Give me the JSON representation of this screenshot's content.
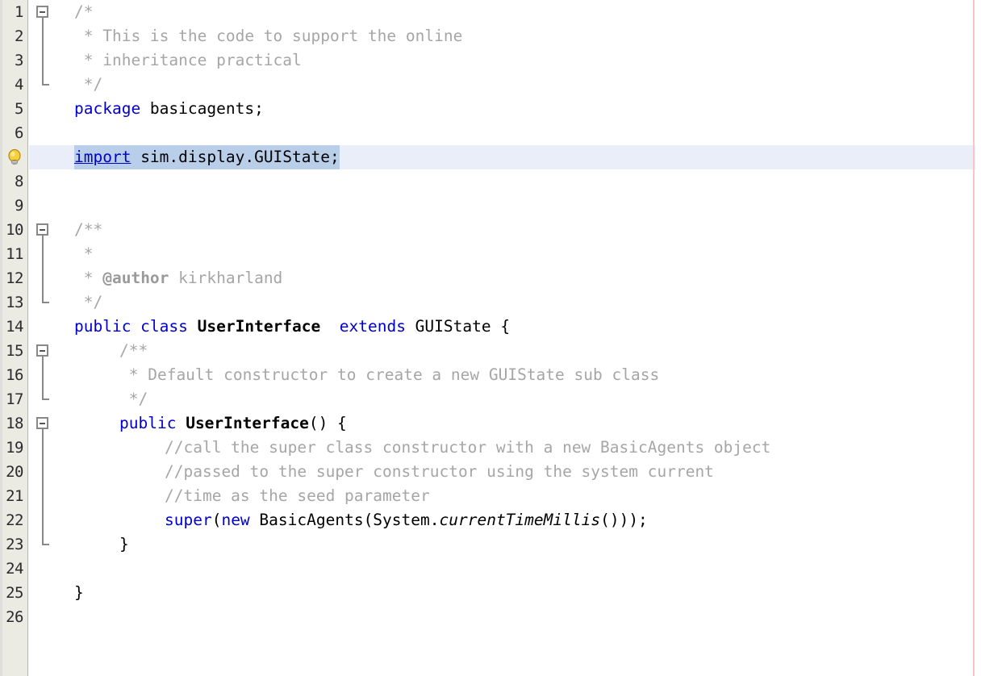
{
  "editor": {
    "language": "java",
    "font_size_px": 19.5,
    "line_height_px": 30,
    "total_lines": 26,
    "current_line": 7,
    "colors": {
      "background": "#ffffff",
      "gutter_background": "#ebebe4",
      "gutter_border": "#b5b5ae",
      "line_number": "#2b2b2b",
      "keyword": "#0000cc",
      "comment": "#a6a6a6",
      "class_name": "#000000",
      "selection": "#b9cfe9",
      "current_line_band": "#e9eef8",
      "fold_marker": "#888888",
      "right_margin_line": "#f5c6c6"
    },
    "gutter": {
      "line_numbers": [
        "1",
        "2",
        "3",
        "4",
        "5",
        "6",
        "",
        "8",
        "9",
        "10",
        "11",
        "12",
        "13",
        "14",
        "15",
        "16",
        "17",
        "18",
        "19",
        "20",
        "21",
        "22",
        "23",
        "24",
        "25",
        "26"
      ],
      "hint_icon": "lightbulb-icon",
      "hint_icon_line": 7,
      "fold_markers": [
        {
          "line": 1,
          "state": "expanded",
          "glyph": "minus-box-icon",
          "ends_at_line": 4
        },
        {
          "line": 7,
          "state": "expanded",
          "glyph": "minus-box-icon",
          "ends_at_line": 7
        },
        {
          "line": 10,
          "state": "expanded",
          "glyph": "minus-box-icon",
          "ends_at_line": 13
        },
        {
          "line": 15,
          "state": "expanded",
          "glyph": "minus-box-icon",
          "ends_at_line": 17
        },
        {
          "line": 18,
          "state": "expanded",
          "glyph": "minus-box-icon",
          "ends_at_line": 23
        }
      ]
    },
    "lines": [
      {
        "n": 1,
        "indent": 0,
        "tokens": [
          {
            "t": "/*",
            "c": "cmt"
          }
        ]
      },
      {
        "n": 2,
        "indent": 0,
        "tokens": [
          {
            "t": " * This is the code to support the online",
            "c": "cmt"
          }
        ]
      },
      {
        "n": 3,
        "indent": 0,
        "tokens": [
          {
            "t": " * inheritance practical",
            "c": "cmt"
          }
        ]
      },
      {
        "n": 4,
        "indent": 0,
        "tokens": [
          {
            "t": " */",
            "c": "cmt"
          }
        ]
      },
      {
        "n": 5,
        "indent": 0,
        "tokens": [
          {
            "t": "package",
            "c": "kw"
          },
          {
            "t": " basicagents;",
            "c": "plain"
          }
        ]
      },
      {
        "n": 6,
        "indent": 0,
        "tokens": []
      },
      {
        "n": 7,
        "indent": 0,
        "current": true,
        "selected": true,
        "tokens": [
          {
            "t": "import",
            "c": "kwu"
          },
          {
            "t": " sim.display.GUIState;",
            "c": "plain"
          }
        ]
      },
      {
        "n": 8,
        "indent": 0,
        "tokens": []
      },
      {
        "n": 9,
        "indent": 0,
        "tokens": []
      },
      {
        "n": 10,
        "indent": 0,
        "tokens": [
          {
            "t": "/**",
            "c": "cmt"
          }
        ]
      },
      {
        "n": 11,
        "indent": 0,
        "tokens": [
          {
            "t": " *",
            "c": "cmt"
          }
        ]
      },
      {
        "n": 12,
        "indent": 0,
        "tokens": [
          {
            "t": " * ",
            "c": "cmt"
          },
          {
            "t": "@author",
            "c": "cmtb"
          },
          {
            "t": " kirkharland",
            "c": "cmt"
          }
        ]
      },
      {
        "n": 13,
        "indent": 0,
        "tokens": [
          {
            "t": " */",
            "c": "cmt"
          }
        ]
      },
      {
        "n": 14,
        "indent": 0,
        "tokens": [
          {
            "t": "public class",
            "c": "kw"
          },
          {
            "t": " ",
            "c": "plain"
          },
          {
            "t": "UserInterface",
            "c": "cls"
          },
          {
            "t": "  ",
            "c": "plain"
          },
          {
            "t": "extends",
            "c": "kw"
          },
          {
            "t": " GUIState {",
            "c": "plain"
          }
        ]
      },
      {
        "n": 15,
        "indent": 4,
        "tokens": [
          {
            "t": "/**",
            "c": "cmt"
          }
        ]
      },
      {
        "n": 16,
        "indent": 4,
        "tokens": [
          {
            "t": " * Default constructor to create a new GUIState sub class",
            "c": "cmt"
          }
        ]
      },
      {
        "n": 17,
        "indent": 4,
        "tokens": [
          {
            "t": " */",
            "c": "cmt"
          }
        ]
      },
      {
        "n": 18,
        "indent": 4,
        "tokens": [
          {
            "t": "public",
            "c": "kw"
          },
          {
            "t": " ",
            "c": "plain"
          },
          {
            "t": "UserInterface",
            "c": "cls"
          },
          {
            "t": "() {",
            "c": "plain"
          }
        ]
      },
      {
        "n": 19,
        "indent": 8,
        "tokens": [
          {
            "t": "//call the super class constructor with a new BasicAgents object",
            "c": "cmt"
          }
        ]
      },
      {
        "n": 20,
        "indent": 8,
        "tokens": [
          {
            "t": "//passed to the super constructor using the system current",
            "c": "cmt"
          }
        ]
      },
      {
        "n": 21,
        "indent": 8,
        "tokens": [
          {
            "t": "//time as the seed parameter",
            "c": "cmt"
          }
        ]
      },
      {
        "n": 22,
        "indent": 8,
        "tokens": [
          {
            "t": "super",
            "c": "kw"
          },
          {
            "t": "(",
            "c": "plain"
          },
          {
            "t": "new",
            "c": "kw"
          },
          {
            "t": " BasicAgents(System.",
            "c": "plain"
          },
          {
            "t": "currentTimeMillis",
            "c": "stat"
          },
          {
            "t": "()));",
            "c": "plain"
          }
        ]
      },
      {
        "n": 23,
        "indent": 4,
        "tokens": [
          {
            "t": "}",
            "c": "plain"
          }
        ]
      },
      {
        "n": 24,
        "indent": 0,
        "tokens": []
      },
      {
        "n": 25,
        "indent": 0,
        "tokens": [
          {
            "t": "}",
            "c": "plain"
          }
        ]
      },
      {
        "n": 26,
        "indent": 0,
        "tokens": []
      }
    ]
  }
}
